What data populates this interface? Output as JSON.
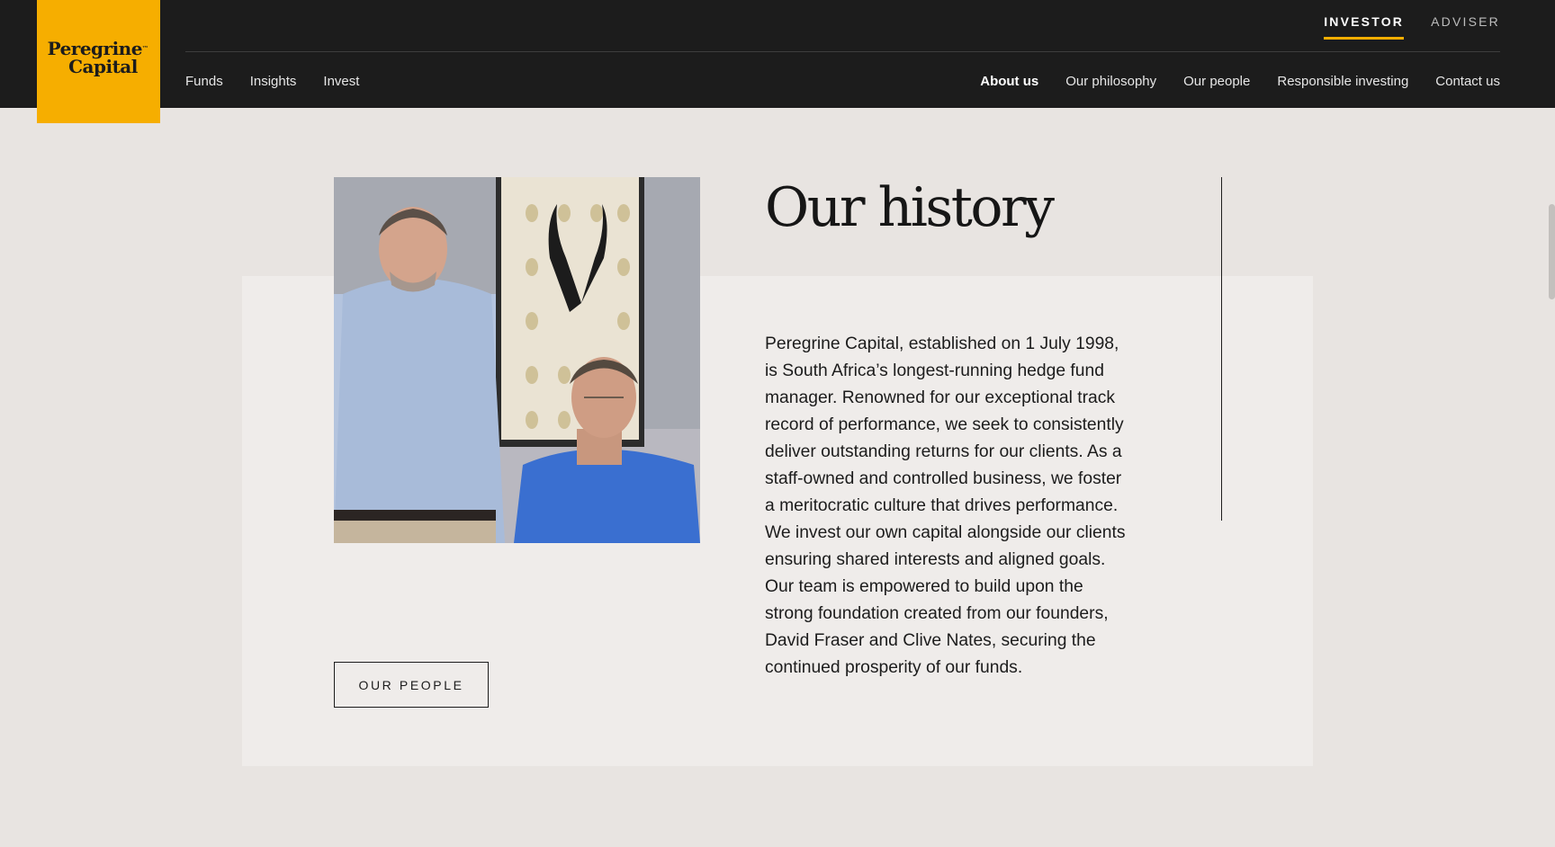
{
  "brand": {
    "line1": "Peregrine",
    "line2": "Capital",
    "tm": "™",
    "color": "#f6ae00"
  },
  "audience_tabs": [
    {
      "label": "INVESTOR",
      "active": true
    },
    {
      "label": "ADVISER",
      "active": false
    }
  ],
  "nav_left": [
    "Funds",
    "Insights",
    "Invest"
  ],
  "nav_right": [
    {
      "label": "About us",
      "active": true
    },
    {
      "label": "Our philosophy",
      "active": false
    },
    {
      "label": "Our people",
      "active": false
    },
    {
      "label": "Responsible investing",
      "active": false
    },
    {
      "label": "Contact us",
      "active": false
    }
  ],
  "section": {
    "title": "Our history",
    "body": "Peregrine Capital, established on 1 July 1998, is South Africa’s longest-running hedge fund manager. Renowned for our exceptional track record of performance, we seek to consistently deliver outstanding returns for our clients. As a staff-owned and controlled business, we foster a meritocratic culture that drives performance. We invest our own capital alongside our clients ensuring shared interests and aligned goals. Our team is empowered to build upon the strong foundation created from our founders, David Fraser and Clive Nates, securing the continued prosperity of our funds.",
    "button_label": "OUR PEOPLE"
  }
}
